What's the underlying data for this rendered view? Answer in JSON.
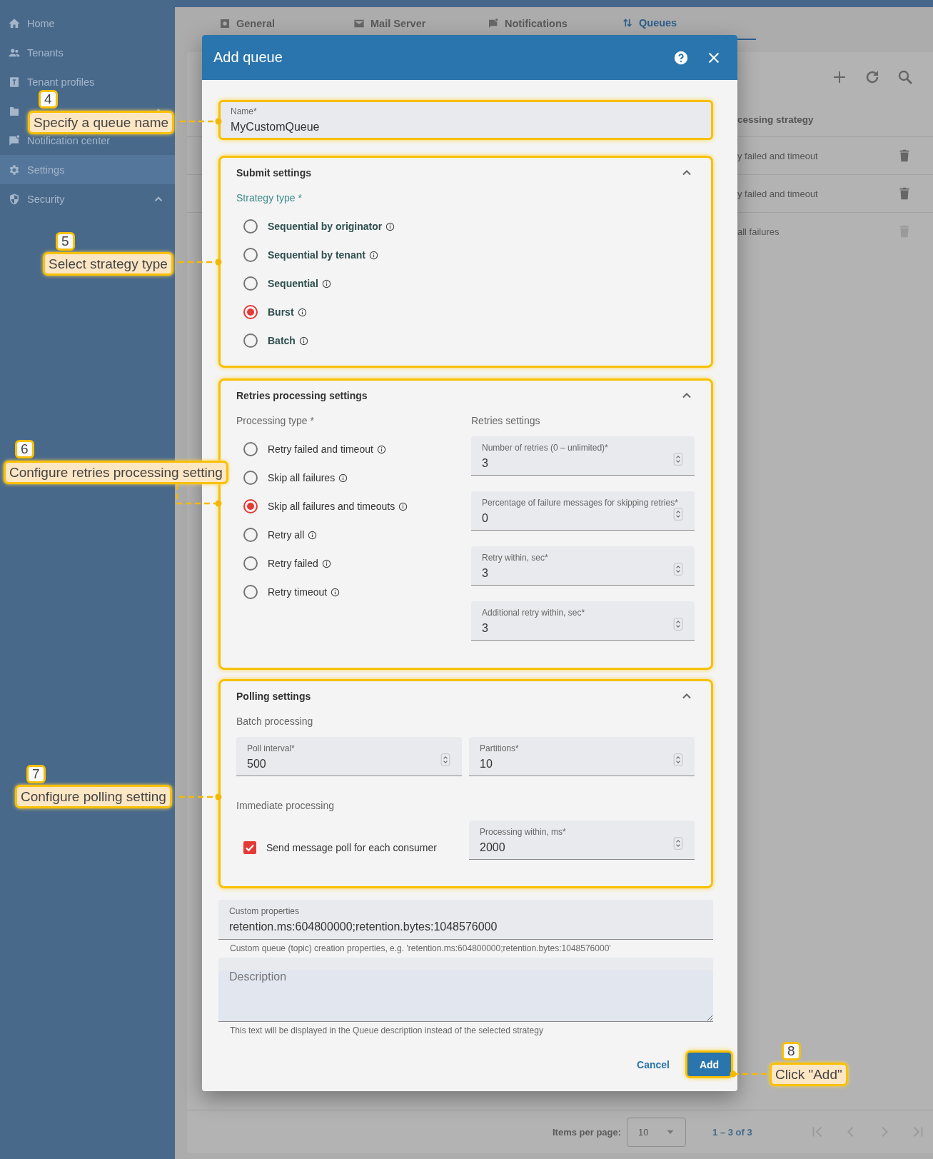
{
  "sidebar": {
    "items": [
      {
        "label": "Home",
        "selected": false
      },
      {
        "label": "Tenants",
        "selected": false
      },
      {
        "label": "Tenant profiles",
        "selected": false
      },
      {
        "selected": false,
        "expanded": true
      },
      {
        "label": "Notification center",
        "selected": false
      },
      {
        "label": "Settings",
        "selected": true
      },
      {
        "label": "Security",
        "selected": false,
        "expanded": true
      }
    ]
  },
  "tabs": [
    {
      "label": "General",
      "selected": false
    },
    {
      "label": "Mail Server",
      "selected": false
    },
    {
      "label": "Notifications",
      "selected": false
    },
    {
      "label": "Queues",
      "selected": true
    }
  ],
  "table": {
    "header": "cessing strategy",
    "rows": [
      {
        "cell": "y failed and timeout",
        "disabled": false
      },
      {
        "cell": "y failed and timeout",
        "disabled": false
      },
      {
        "cell": "all failures",
        "disabled": true
      }
    ]
  },
  "paginator": {
    "label": "Items per page:",
    "page_size": "10",
    "range": "1 – 3 of 3"
  },
  "dialog": {
    "title": "Add queue",
    "name_field": {
      "label": "Name*",
      "value": "MyCustomQueue"
    },
    "submit": {
      "title": "Submit settings",
      "expanded": true,
      "label": "Strategy type *",
      "options": [
        {
          "label": "Sequential by originator",
          "selected": false
        },
        {
          "label": "Sequential by tenant",
          "selected": false
        },
        {
          "label": "Sequential",
          "selected": false
        },
        {
          "label": "Burst",
          "selected": true
        },
        {
          "label": "Batch",
          "selected": false
        }
      ]
    },
    "retries": {
      "title": "Retries processing settings",
      "expanded": true,
      "label": "Processing type *",
      "options": [
        {
          "label": "Retry failed and timeout",
          "selected": false
        },
        {
          "label": "Skip all failures",
          "selected": false
        },
        {
          "label": "Skip all failures and timeouts",
          "selected": true
        },
        {
          "label": "Retry all",
          "selected": false
        },
        {
          "label": "Retry failed",
          "selected": false
        },
        {
          "label": "Retry timeout",
          "selected": false
        }
      ],
      "settings_label": "Retries settings",
      "fields": [
        {
          "label": "Number of retries (0 – unlimited)*",
          "value": "3"
        },
        {
          "label": "Percentage of failure messages for skipping retries*",
          "value": "0"
        },
        {
          "label": "Retry within, sec*",
          "value": "3"
        },
        {
          "label": "Additional retry within, sec*",
          "value": "3"
        }
      ]
    },
    "polling": {
      "title": "Polling settings",
      "expanded": true,
      "batch_label": "Batch processing",
      "batch_fields": [
        {
          "label": "Poll interval*",
          "value": "500"
        },
        {
          "label": "Partitions*",
          "value": "10"
        }
      ],
      "immediate_label": "Immediate processing",
      "checkbox": {
        "label": "Send message poll for each consumer",
        "checked": true
      },
      "immediate_field": {
        "label": "Processing within, ms*",
        "value": "2000"
      }
    },
    "custom_properties": {
      "label": "Custom properties",
      "value": "retention.ms:604800000;retention.bytes:1048576000",
      "hint": "Custom queue (topic) creation properties, e.g. 'retention.ms:604800000;retention.bytes:1048576000'"
    },
    "description": {
      "placeholder": "Description",
      "hint": "This text will be displayed in the Queue description instead of the selected strategy"
    },
    "buttons": {
      "cancel": "Cancel",
      "add": "Add"
    }
  },
  "callouts": [
    {
      "number": "4",
      "text": "Specify a queue name"
    },
    {
      "number": "5",
      "text": "Select strategy type"
    },
    {
      "number": "6",
      "text": "Configure retries processing setting"
    },
    {
      "number": "7",
      "text": "Configure polling setting"
    },
    {
      "number": "8",
      "text": "Click \"Add\""
    }
  ]
}
